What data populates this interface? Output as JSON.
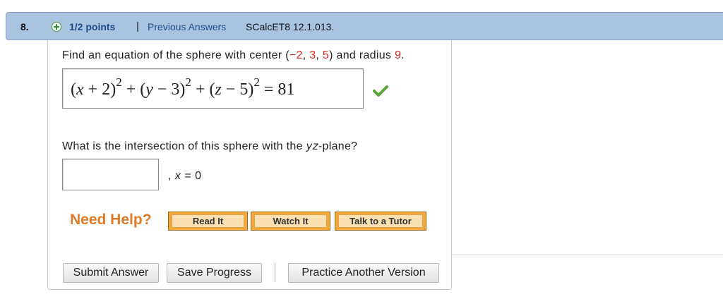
{
  "header": {
    "question_number": "8.",
    "points": "1/2 points",
    "separator": "|",
    "previous_answers": "Previous Answers",
    "source": "SCalcET8 12.1.013."
  },
  "question1": {
    "text_before": "Find an equation of the sphere with center ",
    "open_paren": "(",
    "center_x": "−2",
    "comma1": ", ",
    "center_y": "3",
    "comma2": ", ",
    "center_z": "5",
    "close_paren": ")",
    "text_mid": " and radius ",
    "radius": "9",
    "text_end": "."
  },
  "answer1": {
    "open1": "(",
    "var_x": "x",
    "term1": " + 2)",
    "exp1": "2",
    "plus1": " + (",
    "var_y": "y",
    "term2": " − 3)",
    "exp2": "2",
    "plus2": " + (",
    "var_z": "z",
    "term3": " − 5)",
    "exp3": "2",
    "rhs": " = 81",
    "status_icon": "check-icon",
    "status_color": "#5aa63a"
  },
  "question2": {
    "text_before": "What is the intersection of this sphere with the ",
    "plane": "yz",
    "text_after": "-plane?"
  },
  "answer2": {
    "value": "",
    "suffix_comma": ",  ",
    "suffix_var": "x",
    "suffix_eq": " = 0"
  },
  "help": {
    "label": "Need Help?",
    "read_it": "Read It",
    "watch_it": "Watch It",
    "talk_tutor": "Talk to a Tutor"
  },
  "actions": {
    "submit": "Submit Answer",
    "save": "Save Progress",
    "practice": "Practice Another Version"
  },
  "colors": {
    "header_bg": "#a9c4e0",
    "link": "#1a4d8c",
    "highlight_red": "#d8271c",
    "help_orange": "#e07b27"
  }
}
